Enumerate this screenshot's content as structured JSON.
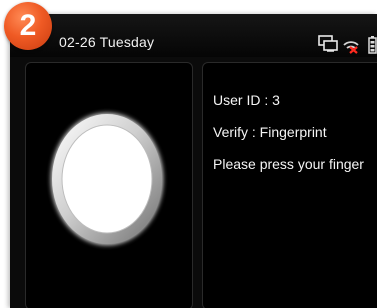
{
  "step_badge": {
    "number": "2"
  },
  "status_bar": {
    "date_text": "02-26  Tuesday",
    "icons": [
      "network-icon",
      "wifi-off-icon",
      "battery-icon"
    ]
  },
  "fingerprint_panel": {
    "icon": "fingerprint-ring-icon"
  },
  "info_panel": {
    "user_id": "User ID : 3",
    "verify": "Verify : Fingerprint",
    "message": "Please press your finger"
  },
  "colors": {
    "badge": "#ef5a24",
    "screen": "#0b0b0b",
    "text": "#f5f5f5"
  }
}
